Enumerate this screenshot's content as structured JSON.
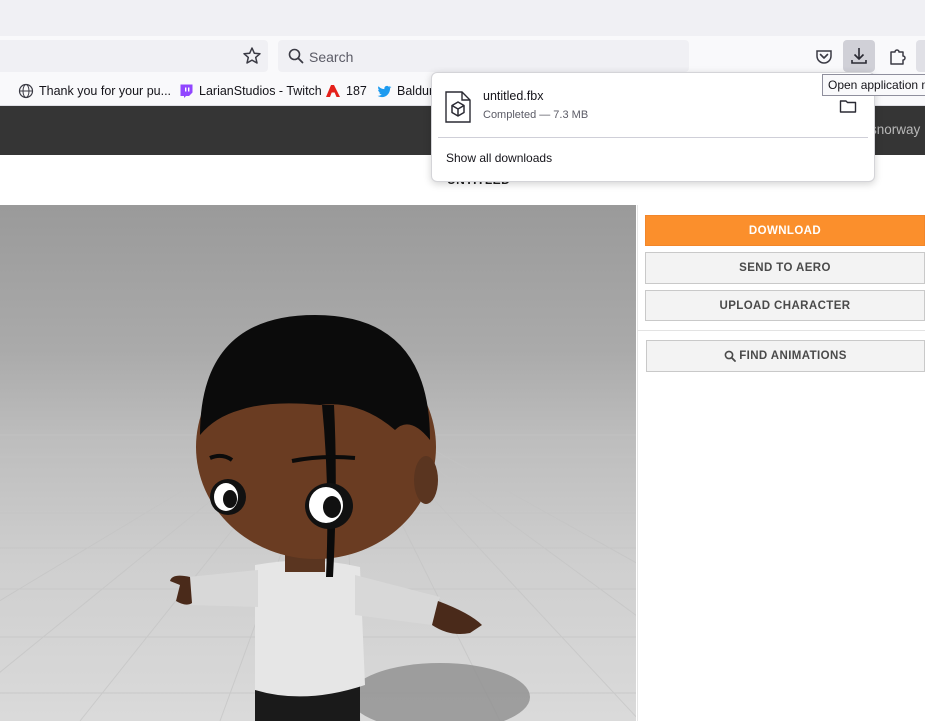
{
  "browser": {
    "search_placeholder": "Search",
    "bookmarks": [
      {
        "label": "Thank you for your pu...",
        "icon": "globe-icon"
      },
      {
        "label": "LarianStudios - Twitch",
        "icon": "twitch-icon"
      },
      {
        "label": "187",
        "icon": "adobe-icon"
      },
      {
        "label": "Baldur",
        "icon": "twitter-icon"
      }
    ],
    "tooltip": "Open application menu"
  },
  "downloads_panel": {
    "filename": "untitled.fbx",
    "status": "Completed — 7.3 MB",
    "show_all": "Show all downloads"
  },
  "site": {
    "user_name": "snorway",
    "character_title": "UNTITLED",
    "buttons": {
      "download": "DOWNLOAD",
      "send_to_aero": "SEND TO AERO",
      "upload_character": "UPLOAD CHARACTER",
      "find_animations": "FIND ANIMATIONS"
    }
  },
  "colors": {
    "accent": "#fb8f2c",
    "site_header": "#353535",
    "toolbar": "#f9f9fb"
  }
}
